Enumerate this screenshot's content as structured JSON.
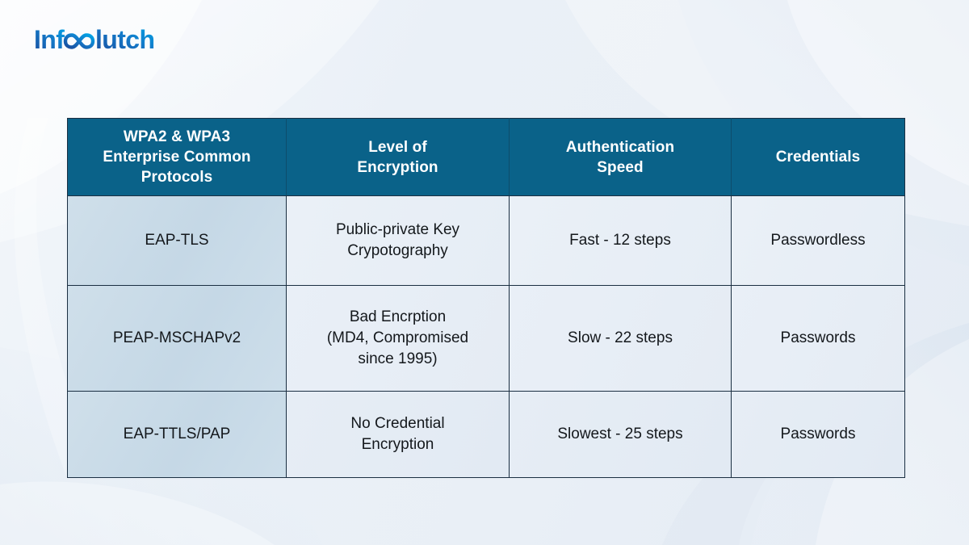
{
  "brand": {
    "logo_text_part1": "Info",
    "logo_symbol": "infinity-symbol",
    "logo_text_part2": "lutch",
    "logo_full": "Infoclutch",
    "colors": {
      "logo_gradient_start": "#1a4d9e",
      "logo_gradient_end": "#00a7e8"
    }
  },
  "theme": {
    "header_bg": "#0a6289",
    "header_text": "#ffffff",
    "first_column_bg": "#cfdfea",
    "cell_bg": "#e7eef6",
    "border": "#1b2f42",
    "page_bg": "#eef3f8",
    "body_text": "#14181c"
  },
  "table": {
    "columns": [
      {
        "id": "protocols",
        "label_lines": [
          "WPA2 & WPA3",
          "Enterprise Common",
          "Protocols"
        ],
        "label": "WPA2 & WPA3 Enterprise Common Protocols"
      },
      {
        "id": "encryption",
        "label_lines": [
          "Level of",
          "Encryption"
        ],
        "label": "Level of Encryption"
      },
      {
        "id": "auth_speed",
        "label_lines": [
          "Authentication",
          "Speed"
        ],
        "label": "Authentication Speed"
      },
      {
        "id": "credentials",
        "label_lines": [
          "Credentials"
        ],
        "label": "Credentials"
      }
    ],
    "rows": [
      {
        "protocol": "EAP-TLS",
        "encryption_lines": [
          "Public-private Key",
          "Crypotography"
        ],
        "encryption": "Public-private Key Crypotography",
        "auth_speed": "Fast - 12 steps",
        "credentials": "Passwordless"
      },
      {
        "protocol": "PEAP-MSCHAPv2",
        "encryption_lines": [
          "Bad Encrption",
          "(MD4, Compromised",
          "since 1995)"
        ],
        "encryption": "Bad Encrption (MD4, Compromised since 1995)",
        "auth_speed": "Slow - 22 steps",
        "credentials": "Passwords"
      },
      {
        "protocol": "EAP-TTLS/PAP",
        "encryption_lines": [
          "No Credential",
          "Encryption"
        ],
        "encryption": "No Credential Encryption",
        "auth_speed": "Slowest - 25 steps",
        "credentials": "Passwords"
      }
    ]
  }
}
